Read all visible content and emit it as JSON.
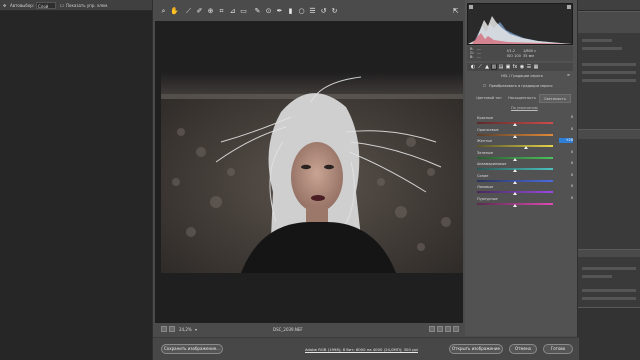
{
  "ps": {
    "topbar": {
      "item1": "Автовыбор:",
      "item2": "Слой",
      "item3": "Показать упр. элем."
    }
  },
  "acr": {
    "toolbar": {
      "tools": [
        "zoom-icon",
        "hand-icon",
        "white-balance-icon",
        "color-sampler-icon",
        "targeted-adjust-icon",
        "crop-icon",
        "straighten-icon",
        "transform-icon",
        "spot-removal-icon",
        "red-eye-icon",
        "adjustment-brush-icon",
        "graduated-filter-icon",
        "radial-filter-icon",
        "preferences-icon",
        "rotate-left-icon",
        "rotate-right-icon"
      ],
      "fullscreen_icon": "fullscreen-icon"
    },
    "camera_info": {
      "r_label": "R:",
      "g_label": "G:",
      "b_label": "B:",
      "r_value": "---",
      "g_value": "---",
      "b_value": "---",
      "aperture": "f/1.2",
      "shutter": "1/800 с",
      "iso": "ISO 100",
      "focal": "35 мм"
    },
    "panel": {
      "section_title": "HSL / Градации серого",
      "convert_gray_label": "Преобразовать в градации серого",
      "subtabs": [
        "Цветовой тон",
        "Насыщенность",
        "Светимость"
      ],
      "active_subtab": "Светимость",
      "defaults_label": "По умолчанию",
      "sliders": [
        {
          "label": "Красные",
          "value": "0",
          "pos": 0.5
        },
        {
          "label": "Оранжевые",
          "value": "0",
          "pos": 0.5
        },
        {
          "label": "Желтые",
          "value": "+28",
          "pos": 0.64,
          "active": true
        },
        {
          "label": "Зеленые",
          "value": "0",
          "pos": 0.5
        },
        {
          "label": "Аквамариновые",
          "value": "0",
          "pos": 0.5
        },
        {
          "label": "Синие",
          "value": "0",
          "pos": 0.5
        },
        {
          "label": "Лиловые",
          "value": "0",
          "pos": 0.5
        },
        {
          "label": "Пурпурные",
          "value": "0",
          "pos": 0.5
        }
      ]
    },
    "status": {
      "zoom": "24,2%",
      "filename": "DSC_2039.NEF"
    },
    "bottom": {
      "save_label": "Сохранить изображение...",
      "workflow_label": "Adobe RGB (1998); 8 бит; 6000 на 4000 (24,0МП); 300 ppi",
      "open_label": "Открыть изображение",
      "cancel_label": "Отмена",
      "done_label": "Готово"
    },
    "colors": {
      "accent": "#2f7fd6",
      "dialog_bg": "#4b4b4b",
      "panel_bg": "#525252"
    }
  }
}
